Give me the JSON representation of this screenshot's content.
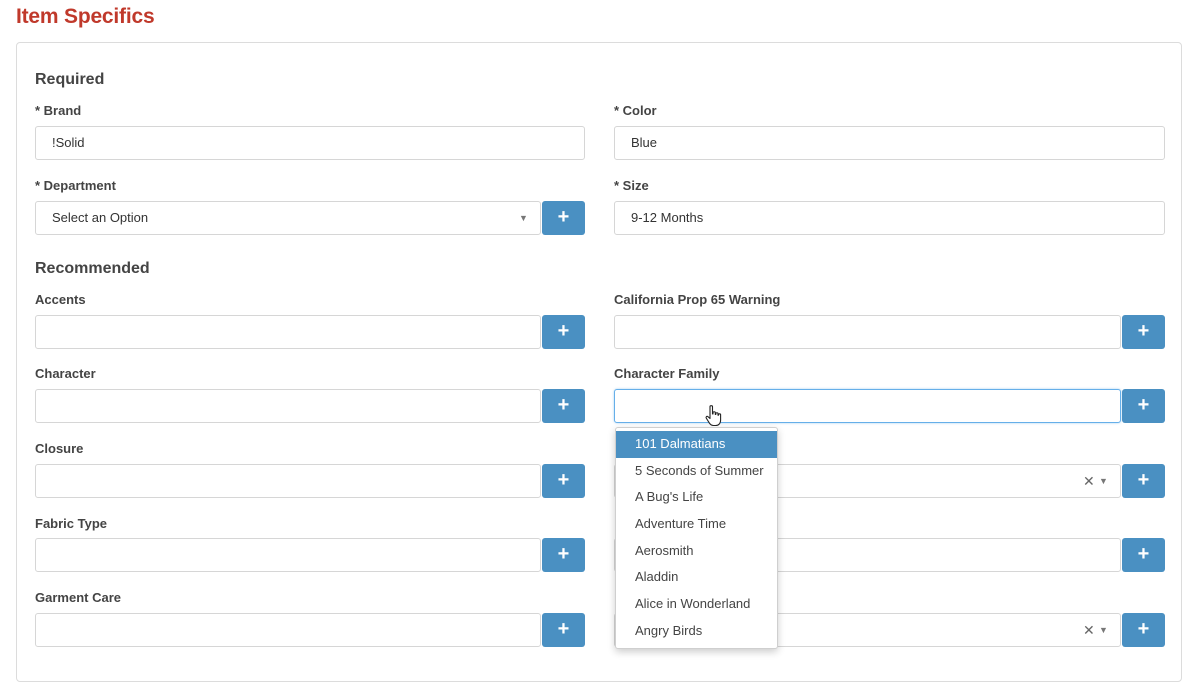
{
  "page": {
    "title": "Item Specifics"
  },
  "sections": {
    "required": "Required",
    "recommended": "Recommended"
  },
  "fields": {
    "brand": {
      "label": "* Brand",
      "value": "!Solid"
    },
    "color": {
      "label": "* Color",
      "value": "Blue"
    },
    "department": {
      "label": "* Department",
      "value": "Select an Option"
    },
    "size": {
      "label": "* Size",
      "value": "9-12 Months"
    },
    "accents": {
      "label": "Accents",
      "value": ""
    },
    "prop65": {
      "label": "California Prop 65 Warning",
      "value": ""
    },
    "character": {
      "label": "Character",
      "value": ""
    },
    "char_family": {
      "label": "Character Family",
      "value": ""
    },
    "closure": {
      "label": "Closure",
      "value": ""
    },
    "fabric_type": {
      "label": "Fabric Type",
      "value": ""
    },
    "garment_care": {
      "label": "Garment Care",
      "value": ""
    }
  },
  "buttons": {
    "add_label": "+"
  },
  "glyphs": {
    "caret": "▼",
    "clear": "✕"
  },
  "dropdown": {
    "options": [
      "101 Dalmatians",
      "5 Seconds of Summer",
      "A Bug's Life",
      "Adventure Time",
      "Aerosmith",
      "Aladdin",
      "Alice in Wonderland",
      "Angry Birds"
    ],
    "highlighted": "101 Dalmatians"
  },
  "colors": {
    "title": "#c0392b",
    "accent": "#4a90c2",
    "focus_border": "#66afe9"
  }
}
